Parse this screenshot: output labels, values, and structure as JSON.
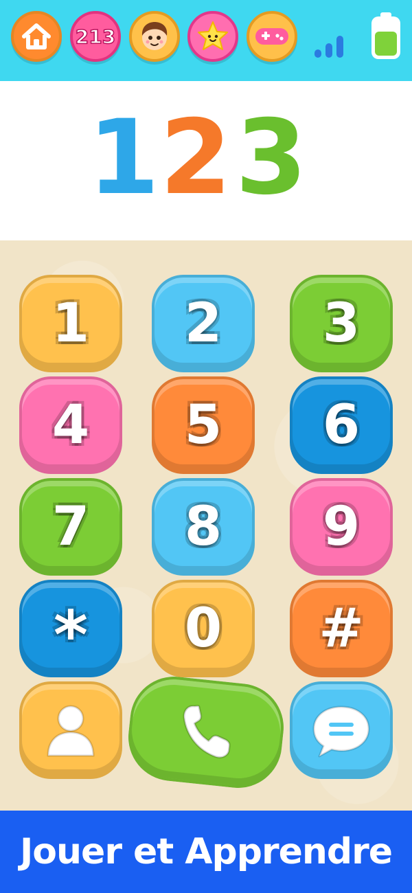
{
  "topbar": {
    "items": [
      {
        "name": "home-icon",
        "color": "#ff8a2e"
      },
      {
        "name": "numbers-icon",
        "color": "#ff5c9e"
      },
      {
        "name": "boy-face-icon",
        "color": "#ffc14a"
      },
      {
        "name": "star-icon",
        "color": "#ff6eb0"
      },
      {
        "name": "gamepad-icon",
        "color": "#ffc04a"
      }
    ],
    "numbers_icon_text": "213",
    "signal_icon": "signal-bars-icon",
    "battery_icon": "battery-icon",
    "background": "#3fd8f0"
  },
  "display": {
    "number": "123",
    "digit_colors": [
      "#2ea7e8",
      "#f5792a",
      "#6abf2e"
    ]
  },
  "keypad": {
    "keys": [
      {
        "label": "1",
        "color": "#ffc14d"
      },
      {
        "label": "2",
        "color": "#52c6f5"
      },
      {
        "label": "3",
        "color": "#7ccd35"
      },
      {
        "label": "4",
        "color": "#ff72b0"
      },
      {
        "label": "5",
        "color": "#ff8a3a"
      },
      {
        "label": "6",
        "color": "#1794de"
      },
      {
        "label": "7",
        "color": "#7ccd35"
      },
      {
        "label": "8",
        "color": "#52c6f5"
      },
      {
        "label": "9",
        "color": "#ff72b0"
      },
      {
        "label": "*",
        "color": "#1794de"
      },
      {
        "label": "0",
        "color": "#ffc14d"
      },
      {
        "label": "#",
        "color": "#ff8a3a"
      }
    ],
    "bottom_row": [
      {
        "icon": "contact-icon",
        "color": "#ffc14d"
      },
      {
        "icon": "phone-call-icon",
        "color": "#7ccd35"
      },
      {
        "icon": "message-icon",
        "color": "#52c6f5"
      }
    ]
  },
  "banner": {
    "text": "Jouer et Apprendre",
    "background": "#1a5ff2"
  }
}
